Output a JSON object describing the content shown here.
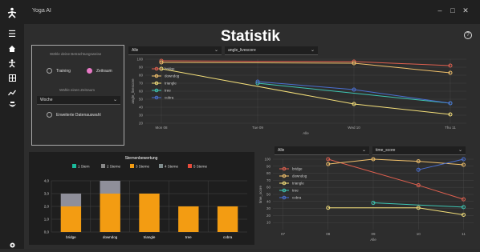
{
  "app": {
    "title": "Yoga AI"
  },
  "window_controls": {
    "minimize": "–",
    "maximize": "□",
    "close": "✕"
  },
  "sidebar": {
    "items": [
      "home-icon",
      "pose-icon",
      "grid-icon",
      "stats-icon",
      "lotus-icon",
      "settings-icon"
    ]
  },
  "page": {
    "title": "Statistik",
    "help": "?"
  },
  "filter_panel": {
    "view_label": "Wähle deine Betrachtungsweise",
    "option_training": "Training",
    "option_period": "Zeitraum",
    "selected": "Zeitraum",
    "period_label": "Wähle einen Zeitraum",
    "period_value": "Woche",
    "extended_label": "Erweiterte Datenauswahl"
  },
  "chart1_controls": {
    "pose_select": "Alle",
    "metric_select": "angle_livescore"
  },
  "chart2_controls": {
    "pose_select": "Alle",
    "metric_select": "time_score"
  },
  "colors": {
    "bridge": "#e0604f",
    "downdog": "#f2c16b",
    "triangle": "#f5e07a",
    "tree": "#3ec6b3",
    "cobra": "#4a6fd1",
    "accent": "#e879c6"
  },
  "chart_data": [
    {
      "type": "line",
      "ylabel": "angle_livescore",
      "xlabel": "Alle",
      "x": [
        "Mon 08",
        "Tue 09",
        "Wed 10",
        "Thu 11"
      ],
      "ylim": [
        20,
        100
      ],
      "yticks": [
        20,
        30,
        40,
        50,
        60,
        70,
        80,
        90,
        100
      ],
      "series": [
        {
          "name": "bridge",
          "points": [
            [
              0,
              98
            ],
            [
              2,
              97
            ],
            [
              3,
              92
            ]
          ]
        },
        {
          "name": "downdog",
          "points": [
            [
              0,
              96
            ],
            [
              2,
              95
            ],
            [
              3,
              83
            ]
          ]
        },
        {
          "name": "triangle",
          "points": [
            [
              0,
              88
            ],
            [
              2,
              44
            ],
            [
              3,
              31
            ]
          ]
        },
        {
          "name": "tree",
          "points": [
            [
              1,
              70
            ],
            [
              3,
              45
            ]
          ]
        },
        {
          "name": "cobra",
          "points": [
            [
              1,
              72
            ],
            [
              2,
              62
            ],
            [
              3,
              45
            ]
          ]
        }
      ]
    },
    {
      "type": "bar",
      "title": "Sternenbewertung",
      "legend": [
        "1 Stern",
        "2 Sterne",
        "3 Sterne",
        "4 Sterne",
        "5 Sterne"
      ],
      "categories": [
        "bridge",
        "downdog",
        "triangle",
        "tree",
        "cobra"
      ],
      "ylim": [
        0,
        4
      ],
      "yticks": [
        "0,0",
        "1,0",
        "2,0",
        "3,0",
        "4,0"
      ],
      "series": [
        {
          "name": "3 Sterne",
          "values": [
            2,
            3,
            3,
            2,
            2
          ]
        },
        {
          "name": "2 Sterne",
          "values": [
            1,
            1,
            0,
            0,
            0
          ]
        }
      ]
    },
    {
      "type": "line",
      "ylabel": "time_score",
      "xlabel": "Alle",
      "x": [
        "07",
        "08",
        "09",
        "10",
        "11"
      ],
      "ylim": [
        0,
        100
      ],
      "yticks": [
        10,
        20,
        30,
        40,
        50,
        60,
        70,
        80,
        90,
        100
      ],
      "series": [
        {
          "name": "bridge",
          "points": [
            [
              1,
              100
            ],
            [
              3,
              63
            ],
            [
              4,
              43
            ]
          ]
        },
        {
          "name": "downdog",
          "points": [
            [
              1,
              93
            ],
            [
              2,
              100
            ],
            [
              3,
              97
            ],
            [
              4,
              92
            ]
          ]
        },
        {
          "name": "triangle",
          "points": [
            [
              1,
              31
            ],
            [
              3,
              31
            ],
            [
              4,
              21
            ]
          ]
        },
        {
          "name": "tree",
          "points": [
            [
              2,
              38
            ],
            [
              4,
              32
            ]
          ]
        },
        {
          "name": "cobra",
          "points": [
            [
              3,
              85
            ],
            [
              4,
              100
            ]
          ]
        }
      ]
    }
  ]
}
